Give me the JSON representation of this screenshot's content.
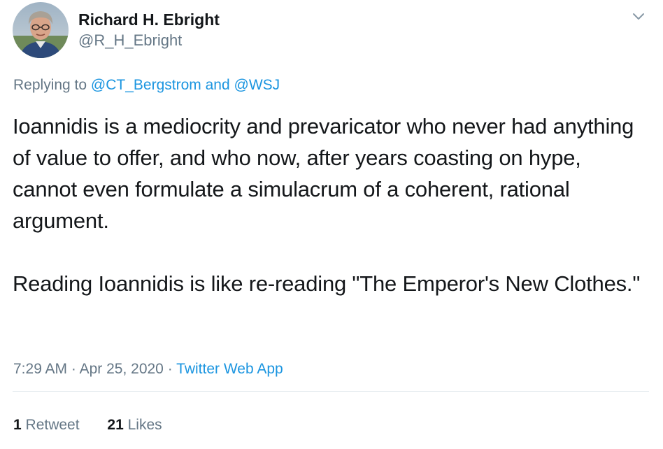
{
  "tweet": {
    "author": {
      "display_name": "Richard H. Ebright",
      "handle": "@R_H_Ebright"
    },
    "replying": {
      "prefix": "Replying to",
      "mention_1": "@CT_Bergstrom",
      "conjunction": "and",
      "mention_2": "@WSJ"
    },
    "paragraphs": [
      "Ioannidis is a mediocrity and prevaricator who never had anything of value to offer, and who now, after years coasting on hype, cannot even formulate a simulacrum of a coherent, rational argument.",
      "Reading Ioannidis is like re-reading \"The Emperor's New Clothes.\""
    ],
    "time": "7:29 AM",
    "separator": "·",
    "date": "Apr 25, 2020",
    "source": "Twitter Web App",
    "stats": {
      "retweets_count": "1",
      "retweets_label": "Retweet",
      "likes_count": "21",
      "likes_label": "Likes"
    }
  },
  "icons": {
    "menu": "chevron-down-icon",
    "avatar": "profile-photo"
  },
  "colors": {
    "link": "#1b95e0",
    "secondary_text": "#657786",
    "primary_text": "#14171a",
    "divider": "#e1e8ed"
  }
}
